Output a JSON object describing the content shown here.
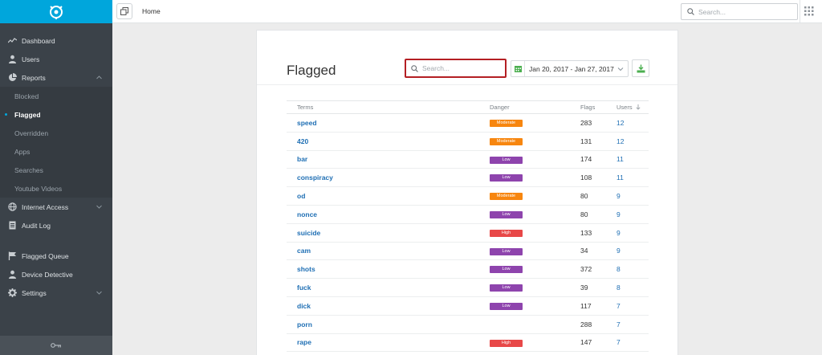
{
  "header": {
    "title": "Home",
    "search_placeholder": "Search..."
  },
  "sidebar": {
    "items": [
      {
        "label": "Dashboard",
        "icon": "chart-line-icon"
      },
      {
        "label": "Users",
        "icon": "user-icon"
      },
      {
        "label": "Reports",
        "icon": "pie-chart-icon",
        "expanded": true,
        "children": [
          {
            "label": "Blocked"
          },
          {
            "label": "Flagged",
            "active": true
          },
          {
            "label": "Overridden"
          },
          {
            "label": "Apps"
          },
          {
            "label": "Searches"
          },
          {
            "label": "Youtube Videos"
          }
        ]
      },
      {
        "label": "Internet Access",
        "icon": "globe-icon"
      },
      {
        "label": "Audit Log",
        "icon": "document-icon"
      },
      {
        "label": "Flagged Queue",
        "icon": "flag-icon"
      },
      {
        "label": "Device Detective",
        "icon": "user-icon"
      },
      {
        "label": "Settings",
        "icon": "gear-icon"
      }
    ]
  },
  "main": {
    "title": "Flagged",
    "search_placeholder": "Search...",
    "date_range": "Jan 20, 2017 - Jan 27, 2017",
    "table": {
      "columns": [
        "Terms",
        "Danger",
        "Flags",
        "Users"
      ],
      "sort_column": "Users",
      "rows": [
        {
          "term": "speed",
          "danger": "Moderate",
          "flags": "283",
          "users": "12"
        },
        {
          "term": "420",
          "danger": "Moderate",
          "flags": "131",
          "users": "12"
        },
        {
          "term": "bar",
          "danger": "Low",
          "flags": "174",
          "users": "11"
        },
        {
          "term": "conspiracy",
          "danger": "Low",
          "flags": "108",
          "users": "11"
        },
        {
          "term": "od",
          "danger": "Moderate",
          "flags": "80",
          "users": "9"
        },
        {
          "term": "nonce",
          "danger": "Low",
          "flags": "80",
          "users": "9"
        },
        {
          "term": "suicide",
          "danger": "High",
          "flags": "133",
          "users": "9"
        },
        {
          "term": "cam",
          "danger": "Low",
          "flags": "34",
          "users": "9"
        },
        {
          "term": "shots",
          "danger": "Low",
          "flags": "372",
          "users": "8"
        },
        {
          "term": "fuck",
          "danger": "Low",
          "flags": "39",
          "users": "8"
        },
        {
          "term": "dick",
          "danger": "Low",
          "flags": "117",
          "users": "7"
        },
        {
          "term": "porn",
          "danger": "",
          "flags": "288",
          "users": "7"
        },
        {
          "term": "rape",
          "danger": "High",
          "flags": "147",
          "users": "7"
        }
      ]
    }
  },
  "colors": {
    "accent": "#00a6dc",
    "sidebar": "#3b4249",
    "link": "#1f6fb4",
    "moderate": "#f7860f",
    "low": "#8e44ad",
    "high": "#e84848",
    "highlight": "#b41f24"
  }
}
